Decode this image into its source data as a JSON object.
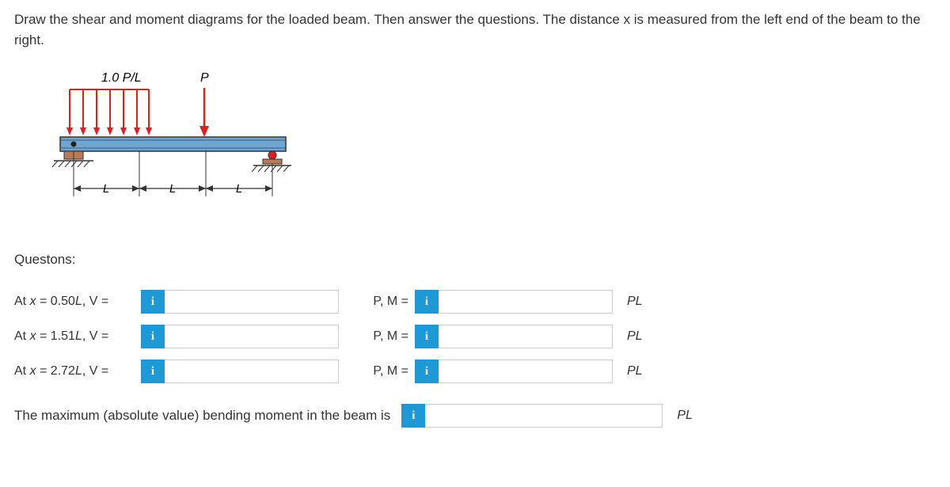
{
  "instructions": "Draw the shear and moment diagrams for the loaded beam. Then answer the questions. The distance x is measured from the left end of the beam to the right.",
  "diagram": {
    "distributed_load_label": "1.0 P/L",
    "point_load_label": "P",
    "span_labels": [
      "L",
      "L",
      "L"
    ]
  },
  "questions_header": "Questons:",
  "rows": [
    {
      "xlabel": "At x = 0.50L, V =",
      "mlabel": "P, M =",
      "unit1": "P,",
      "unit2": "PL"
    },
    {
      "xlabel": "At x = 1.51L, V =",
      "mlabel": "P, M =",
      "unit1": "P,",
      "unit2": "PL"
    },
    {
      "xlabel": "At x = 2.72L, V =",
      "mlabel": "P, M =",
      "unit1": "P,",
      "unit2": "PL"
    }
  ],
  "max_label": "The maximum (absolute value) bending moment in the beam is",
  "max_unit": "PL",
  "info_icon": "i"
}
